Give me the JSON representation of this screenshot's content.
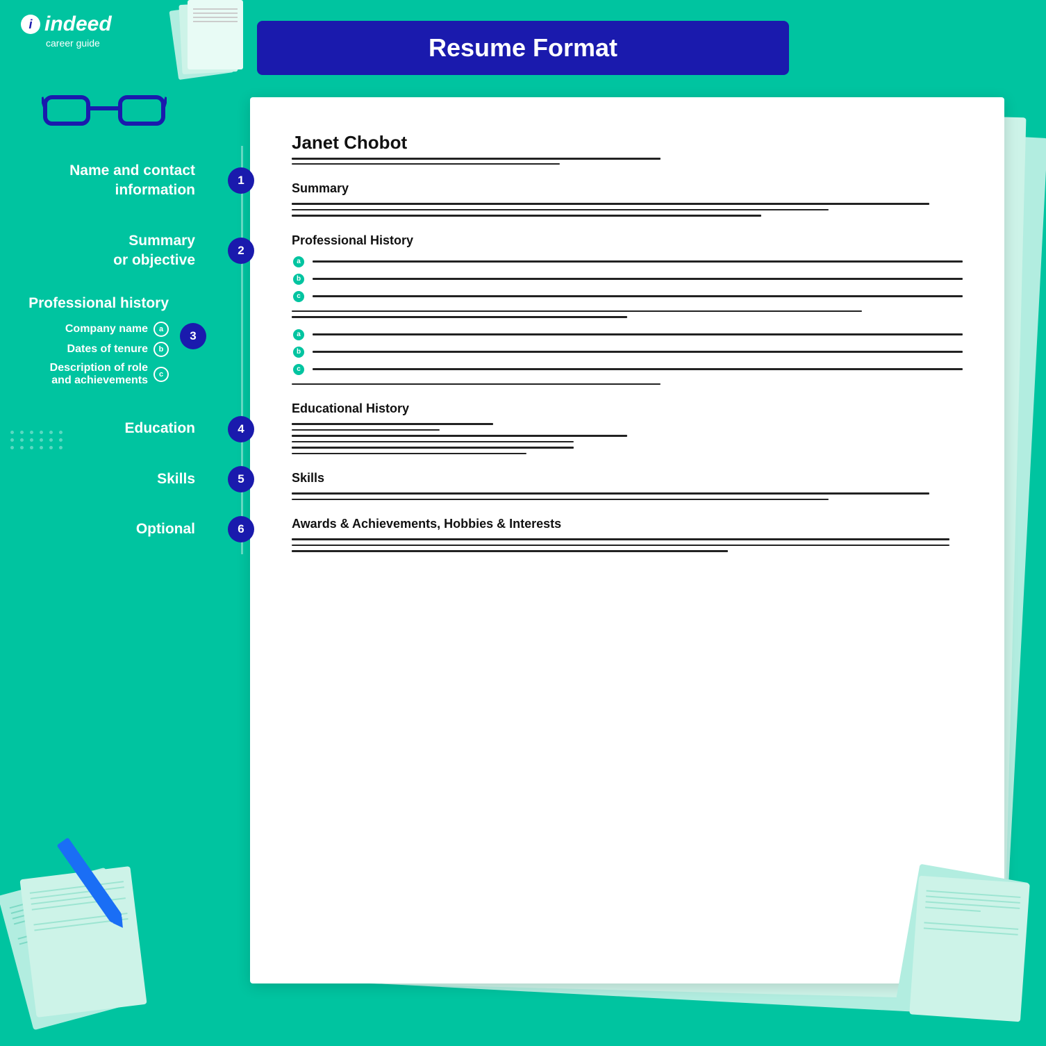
{
  "header": {
    "title": "Resume Format"
  },
  "logo": {
    "name": "indeed",
    "subtitle": "career guide"
  },
  "sidebar": {
    "items": [
      {
        "label": "Name and contact\ninformation",
        "number": "1"
      },
      {
        "label": "Summary\nor objective",
        "number": "2"
      },
      {
        "label": "Professional history",
        "number": "3"
      },
      {
        "label": "Company name",
        "letter": "a"
      },
      {
        "label": "Dates of tenure",
        "letter": "b"
      },
      {
        "label": "Description of role\nand achievements",
        "letter": "c"
      },
      {
        "label": "Education",
        "number": "4"
      },
      {
        "label": "Skills",
        "number": "5"
      },
      {
        "label": "Optional",
        "number": "6"
      }
    ]
  },
  "resume": {
    "name": "Janet Chobot",
    "sections": [
      {
        "title": "Summary"
      },
      {
        "title": "Professional History"
      },
      {
        "title": "Educational History"
      },
      {
        "title": "Skills"
      },
      {
        "title": "Awards & Achievements, Hobbies & Interests"
      }
    ]
  }
}
